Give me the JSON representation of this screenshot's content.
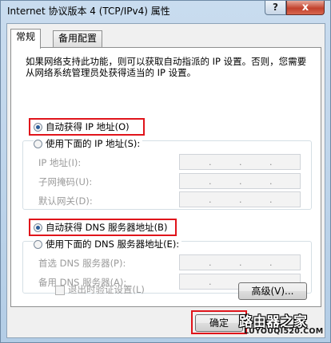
{
  "window": {
    "title": "Internet 协议版本 4 (TCP/IPv4) 属性",
    "help_label": "?",
    "close_label": "x"
  },
  "tabs": [
    {
      "label": "常规",
      "active": true
    },
    {
      "label": "备用配置",
      "active": false
    }
  ],
  "description": "如果网络支持此功能，则可以获取自动指派的 IP 设置。否则，您需要从网络系统管理员处获得适当的 IP 设置。",
  "ip_section": {
    "auto_label": "自动获得 IP 地址(O)",
    "auto_selected": true,
    "manual_label": "使用下面的 IP 地址(S):",
    "fields": [
      {
        "label": "IP 地址(I):",
        "value": ". . ."
      },
      {
        "label": "子网掩码(U):",
        "value": ". . ."
      },
      {
        "label": "默认网关(D):",
        "value": ". . ."
      }
    ]
  },
  "dns_section": {
    "auto_label": "自动获得 DNS 服务器地址(B)",
    "auto_selected": true,
    "manual_label": "使用下面的 DNS 服务器地址(E):",
    "fields": [
      {
        "label": "首选 DNS 服务器(P):",
        "value": ". . ."
      },
      {
        "label": "备用 DNS 服务器(A):",
        "value": ". . ."
      }
    ]
  },
  "validate_checkbox": {
    "label": "退出时验证设置(L)",
    "checked": false
  },
  "advanced_button": "高级(V)...",
  "ok_button": "确定",
  "watermark": {
    "line1": "路由器之家",
    "line2": "LUYOUQI520.COM"
  },
  "colors": {
    "highlight": "#e0141b",
    "accent": "#2a5d9a"
  }
}
